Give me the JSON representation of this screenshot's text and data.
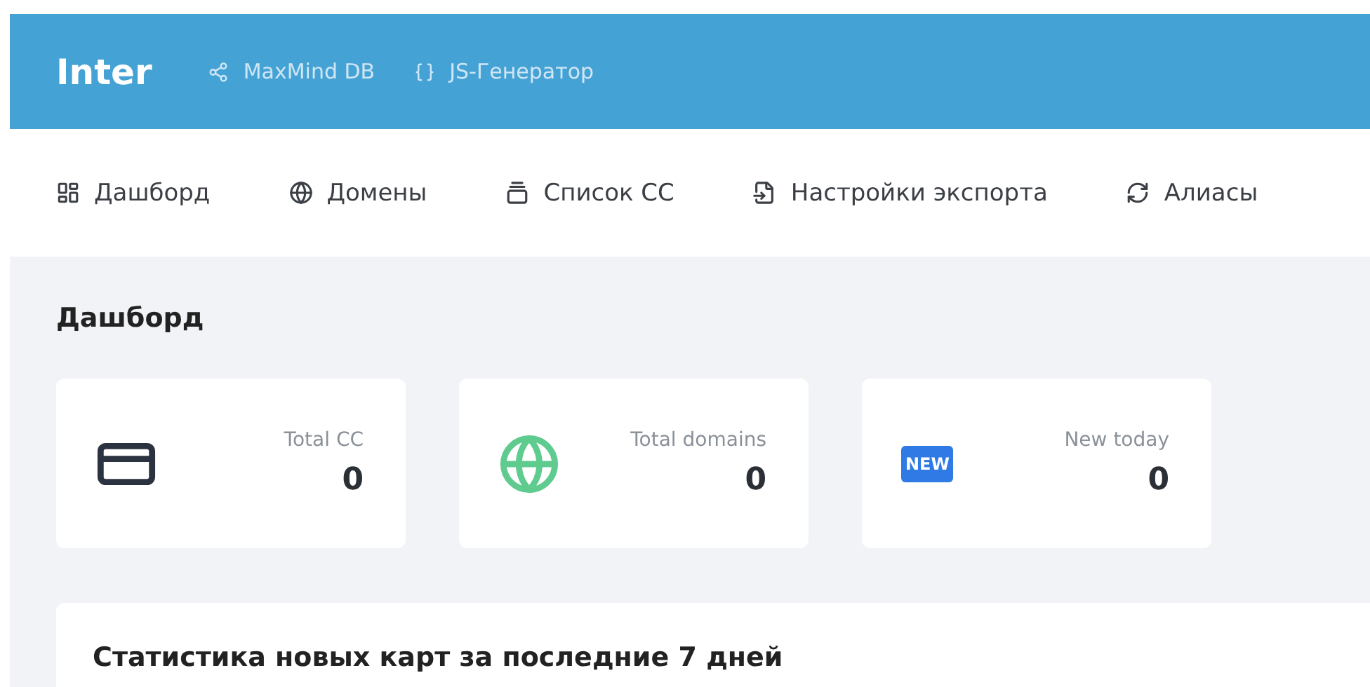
{
  "header": {
    "brand": "Inter",
    "links": [
      {
        "kind": "graph",
        "label": "MaxMind DB"
      },
      {
        "kind": "braces",
        "label": "JS-Генератор"
      }
    ]
  },
  "nav": [
    {
      "kind": "dashboard",
      "label": "Дашборд"
    },
    {
      "kind": "globe",
      "label": "Домены"
    },
    {
      "kind": "list",
      "label": "Список CC"
    },
    {
      "kind": "file",
      "label": "Настройки экспорта"
    },
    {
      "kind": "sync",
      "label": "Алиасы"
    }
  ],
  "page_title": "Дашборд",
  "stats": [
    {
      "kind": "card",
      "label": "Total CC",
      "value": "0"
    },
    {
      "kind": "globe",
      "label": "Total domains",
      "value": "0"
    },
    {
      "kind": "new",
      "badge": "NEW",
      "label": "New today",
      "value": "0"
    }
  ],
  "chart_panel": {
    "title": "Статистика новых карт за последние 7 дней"
  }
}
